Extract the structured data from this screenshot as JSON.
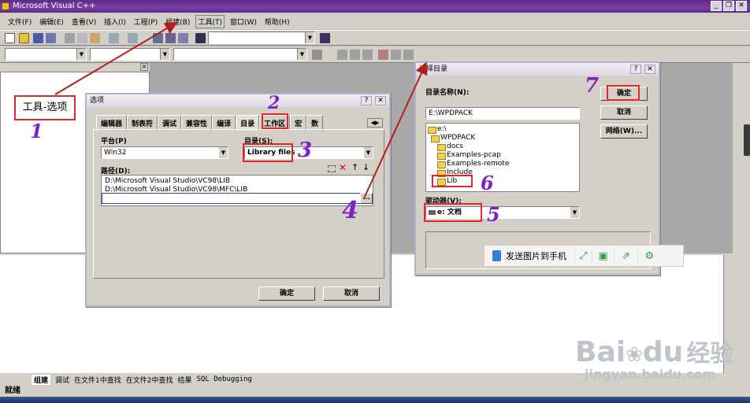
{
  "window": {
    "title": "Microsoft Visual C++",
    "buttons": [
      "_",
      "❐",
      "✕"
    ]
  },
  "menu": {
    "items": [
      "文件(F)",
      "编辑(E)",
      "查看(V)",
      "插入(I)",
      "工程(P)",
      "组建(B)",
      "工具(T)",
      "窗口(W)",
      "帮助(H)"
    ]
  },
  "annotation": {
    "label": "工具-选项"
  },
  "options_dialog": {
    "title": "选项",
    "help": "?",
    "close": "✕",
    "tabs": [
      "编辑器",
      "制表符",
      "调试",
      "兼容性",
      "编译",
      "目录",
      "工作区",
      "宏",
      "数"
    ],
    "platform_label": "平台(P)",
    "platform_value": "Win32",
    "dir_label": "目录(S):",
    "dir_value": "Library files",
    "path_label": "路径(D):",
    "paths": [
      "D:\\Microsoft Visual Studio\\VC98\\LIB",
      "D:\\Microsoft Visual Studio\\VC98\\MFC\\LIB"
    ],
    "browse": "...",
    "ok": "确定",
    "cancel": "取消"
  },
  "dir_dialog": {
    "title": "选择目录",
    "help": "?",
    "close": "✕",
    "name_label": "目录名称(N):",
    "name_value": "E:\\WPDPACK",
    "ok": "确定",
    "cancel": "取消",
    "network": "网络(W)...",
    "tree": [
      "e:\\",
      "WPDPACK",
      "docs",
      "Examples-pcap",
      "Examples-remote",
      "Include",
      "Lib"
    ],
    "drive_label": "驱动器(V):",
    "drive_value": "e: 文档"
  },
  "handwritten": [
    "1",
    "2",
    "3",
    "4",
    "5",
    "6",
    "7"
  ],
  "output_tabs": [
    "组建",
    "调试",
    "在文件1中查找",
    "在文件2中查找",
    "结果",
    "SQL Debugging"
  ],
  "status": {
    "text": "就绪"
  },
  "share_toolbar": {
    "label": "发送图片到手机"
  },
  "watermark": {
    "brand": "Bai",
    "brand2": "du",
    "cn": "经验",
    "url": "jingyan.baidu.com"
  },
  "colors": {
    "title_bar": "#5b2a86",
    "annotation_red": "#e02828",
    "handwriting": "#8020c8",
    "arrow": "#b02020"
  }
}
